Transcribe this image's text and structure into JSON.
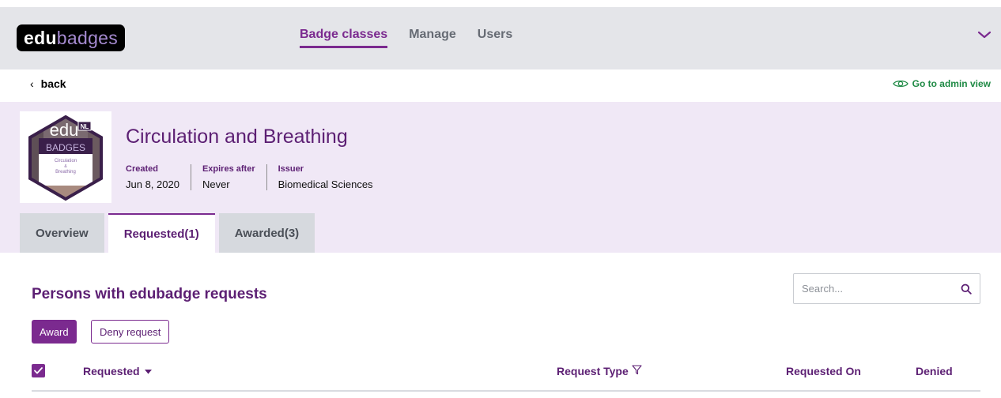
{
  "header": {
    "logo_prefix": "edu",
    "logo_suffix": "badges",
    "nav": [
      {
        "label": "Badge classes",
        "active": true
      },
      {
        "label": "Manage",
        "active": false
      },
      {
        "label": "Users",
        "active": false
      }
    ]
  },
  "backbar": {
    "back_label": "back",
    "admin_link": "Go to admin view"
  },
  "badge": {
    "image_text": {
      "top": "edu",
      "badge_word": "BADGES",
      "ribbon": "NL",
      "sub1": "Circulation",
      "sub2": "&",
      "sub3": "Breathing"
    },
    "title": "Circulation and Breathing",
    "meta": [
      {
        "label": "Created",
        "value": "Jun 8, 2020"
      },
      {
        "label": "Expires after",
        "value": "Never"
      },
      {
        "label": "Issuer",
        "value": "Biomedical Sciences"
      }
    ]
  },
  "tabs": [
    {
      "label": "Overview",
      "active": false
    },
    {
      "label": "Requested(1)",
      "active": true
    },
    {
      "label": "Awarded(3)",
      "active": false
    }
  ],
  "requests": {
    "title": "Persons with edubadge requests",
    "search_placeholder": "Search...",
    "award_label": "Award",
    "deny_label": "Deny request",
    "columns": {
      "requested": "Requested",
      "request_type": "Request Type",
      "requested_on": "Requested On",
      "denied": "Denied"
    }
  },
  "colors": {
    "accent": "#7b2a8f",
    "title": "#5c1f73",
    "hero_bg": "#f0e8f6",
    "link_green": "#1f8a45",
    "topbar_bg": "#e4e5e9"
  }
}
